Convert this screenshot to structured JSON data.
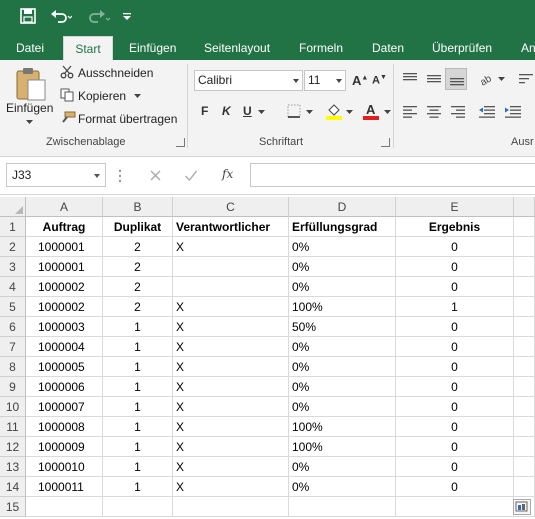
{
  "colors": {
    "accent": "#217346",
    "ribbon_bg": "#f3f3f3",
    "grid_line": "#dadada"
  },
  "quick_access": {
    "save_icon": "save-icon",
    "undo_icon": "undo-icon",
    "redo_icon": "redo-icon",
    "customize_icon": "customize-qat-icon"
  },
  "tabs": [
    "Datei",
    "Start",
    "Einfügen",
    "Seitenlayout",
    "Formeln",
    "Daten",
    "Überprüfen",
    "An"
  ],
  "active_tab": "Start",
  "ribbon": {
    "clipboard": {
      "paste_label": "Einfügen",
      "cut_label": "Ausschneiden",
      "copy_label": "Kopieren",
      "format_painter_label": "Format übertragen",
      "group_label": "Zwischenablage"
    },
    "font": {
      "font_name": "Calibri",
      "font_size": "11",
      "bold_label": "F",
      "italic_label": "K",
      "underline_label": "U",
      "grow_label": "A",
      "shrink_label": "A",
      "group_label": "Schriftart"
    },
    "alignment": {
      "group_label": "Ausr"
    }
  },
  "formula_bar": {
    "name_box": "J33",
    "fx_label": "fx",
    "formula": ""
  },
  "sheet": {
    "columns": [
      "A",
      "B",
      "C",
      "D",
      "E"
    ],
    "rows": [
      [
        "Auftrag",
        "Duplikat",
        "Verantwortlicher",
        "Erfüllungsgrad",
        "Ergebnis"
      ],
      [
        "1000001",
        "2",
        "X",
        "0%",
        "0"
      ],
      [
        "1000001",
        "2",
        "",
        "0%",
        "0"
      ],
      [
        "1000002",
        "2",
        "",
        "0%",
        "0"
      ],
      [
        "1000002",
        "2",
        "X",
        "100%",
        "1"
      ],
      [
        "1000003",
        "1",
        "X",
        "50%",
        "0"
      ],
      [
        "1000004",
        "1",
        "X",
        "0%",
        "0"
      ],
      [
        "1000005",
        "1",
        "X",
        "0%",
        "0"
      ],
      [
        "1000006",
        "1",
        "X",
        "0%",
        "0"
      ],
      [
        "1000007",
        "1",
        "X",
        "0%",
        "0"
      ],
      [
        "1000008",
        "1",
        "X",
        "100%",
        "0"
      ],
      [
        "1000009",
        "1",
        "X",
        "100%",
        "0"
      ],
      [
        "1000010",
        "1",
        "X",
        "0%",
        "0"
      ],
      [
        "1000011",
        "1",
        "X",
        "0%",
        "0"
      ],
      [
        "",
        "",
        "",
        "",
        ""
      ]
    ]
  }
}
